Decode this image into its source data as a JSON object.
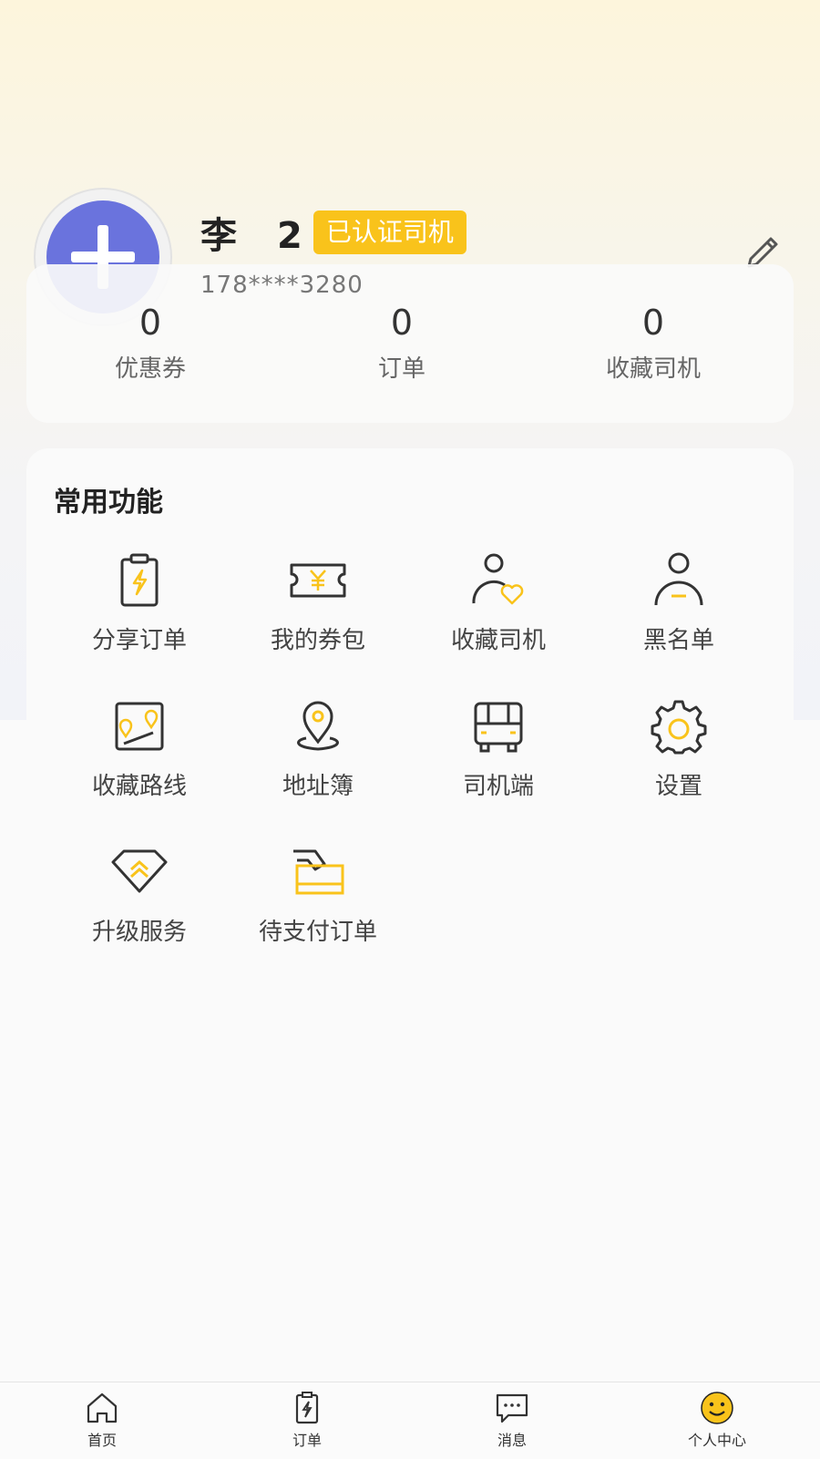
{
  "profile": {
    "name": "李　2",
    "badge": "已认证司机",
    "phone": "178****3280"
  },
  "stats": [
    {
      "value": "0",
      "label": "优惠券"
    },
    {
      "value": "0",
      "label": "订单"
    },
    {
      "value": "0",
      "label": "收藏司机"
    }
  ],
  "functions": {
    "title": "常用功能",
    "items": [
      {
        "label": "分享订单",
        "icon": "share-order-icon"
      },
      {
        "label": "我的券包",
        "icon": "coupon-icon"
      },
      {
        "label": "收藏司机",
        "icon": "favorite-driver-icon"
      },
      {
        "label": "黑名单",
        "icon": "blacklist-icon"
      },
      {
        "label": "收藏路线",
        "icon": "favorite-route-icon"
      },
      {
        "label": "地址簿",
        "icon": "address-book-icon"
      },
      {
        "label": "司机端",
        "icon": "driver-app-icon"
      },
      {
        "label": "设置",
        "icon": "settings-icon"
      },
      {
        "label": "升级服务",
        "icon": "upgrade-icon"
      },
      {
        "label": "待支付订单",
        "icon": "pending-payment-icon"
      }
    ]
  },
  "tabbar": [
    {
      "label": "首页",
      "icon": "home-icon"
    },
    {
      "label": "订单",
      "icon": "order-icon"
    },
    {
      "label": "消息",
      "icon": "message-icon"
    },
    {
      "label": "个人中心",
      "icon": "smiley-icon",
      "active": true
    }
  ],
  "colors": {
    "accent": "#f9c31b",
    "avatar": "#6a73dd",
    "icon_dark": "#333333"
  }
}
